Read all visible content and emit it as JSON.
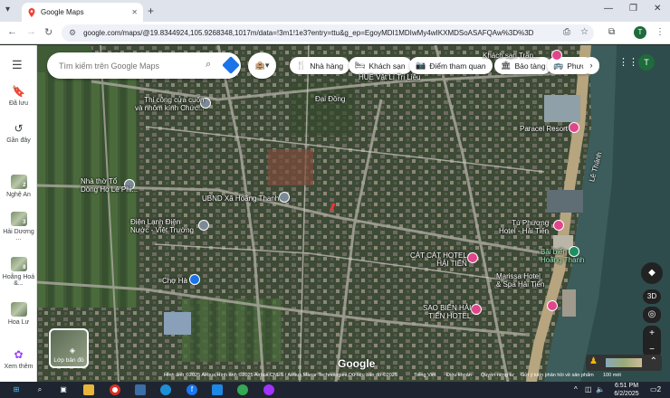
{
  "browser": {
    "tab_title": "Google Maps",
    "url": "google.com/maps/@19.8344924,105.9268348,1017m/data=!3m1!1e3?entry=ttu&g_ep=EgoyMDI1MDIwMy4wIKXMDSoASAFQAw%3D%3D",
    "profile_initial": "T"
  },
  "sidebar": {
    "items": [
      {
        "label": "Đã lưu",
        "icon": "bookmark-icon"
      },
      {
        "label": "Gần đây",
        "icon": "history-icon"
      }
    ],
    "recents": [
      {
        "label": "Nghệ An",
        "badge": "2"
      },
      {
        "label": "Hải Dương ...",
        "badge": "3"
      },
      {
        "label": "Hoằng Hoá &...",
        "badge": "8"
      },
      {
        "label": "Hoa Lư",
        "badge": ""
      },
      {
        "label": "Xem thêm",
        "badge": ""
      }
    ]
  },
  "search": {
    "placeholder": "Tìm kiếm trên Google Maps"
  },
  "chips": [
    {
      "label": "Nhà hàng",
      "icon": "fork-knife-icon"
    },
    {
      "label": "Khách sạn",
      "icon": "bed-icon"
    },
    {
      "label": "Điểm tham quan",
      "icon": "camera-icon"
    },
    {
      "label": "Bảo tàng",
      "icon": "museum-icon"
    },
    {
      "label": "Phươ",
      "icon": "bus-icon"
    }
  ],
  "places": [
    {
      "name": "Thi công cửa cuốn\nvà nhôm kính Chức...",
      "kind": "gray"
    },
    {
      "name": "Nhà thờ Tổ\nDòng Họ Lê Phi...",
      "kind": "gray"
    },
    {
      "name": "UBND Xã Hoằng Thanh",
      "kind": "gray"
    },
    {
      "name": "Điện Lạnh Điện\nNước - Việt Trường",
      "kind": "gray"
    },
    {
      "name": "Chợ Hà",
      "kind": "blue"
    },
    {
      "name": "Đại Đồng",
      "kind": "label"
    },
    {
      "name": "HUE Vật Lí Trị Liệu",
      "kind": "label"
    },
    {
      "name": "Paracel Resort",
      "kind": "pink"
    },
    {
      "name": "Tú Phương\nHotel - Hải Tiến",
      "kind": "pink"
    },
    {
      "name": "Bãi biển\nHoằng Thanh",
      "kind": "green"
    },
    {
      "name": "CÁT CÁT HOTEL\nHẢI TIẾN",
      "kind": "pink"
    },
    {
      "name": "Marissa Hotel\n& Spa Hải Tiến",
      "kind": "pink"
    },
    {
      "name": "SAO BIỂN HẢI\nTIẾN HOTEL",
      "kind": "pink"
    },
    {
      "name": "Khách sạn Trần...",
      "kind": "pink"
    }
  ],
  "map": {
    "layers_label": "Lớp bản đồ",
    "google_logo": "Google",
    "road_label": "Lê Thánh",
    "attribution": "Hình ảnh ©2025 Airbus,Hình ảnh ©2025 Airbus,CNES / Airbus,Maxar Technologies,Dữ liệu bản đồ ©2025",
    "footer_links": [
      "Tiếng Việt",
      "Điều khoản",
      "Quyền riêng tư",
      "Gửi ý kiến phản hồi về sản phẩm"
    ],
    "scale": "100 mét",
    "btn_3d": "3D"
  },
  "taskbar": {
    "time": "6:51 PM",
    "date": "6/2/2025",
    "notif": "2",
    "lang": "ENG"
  }
}
